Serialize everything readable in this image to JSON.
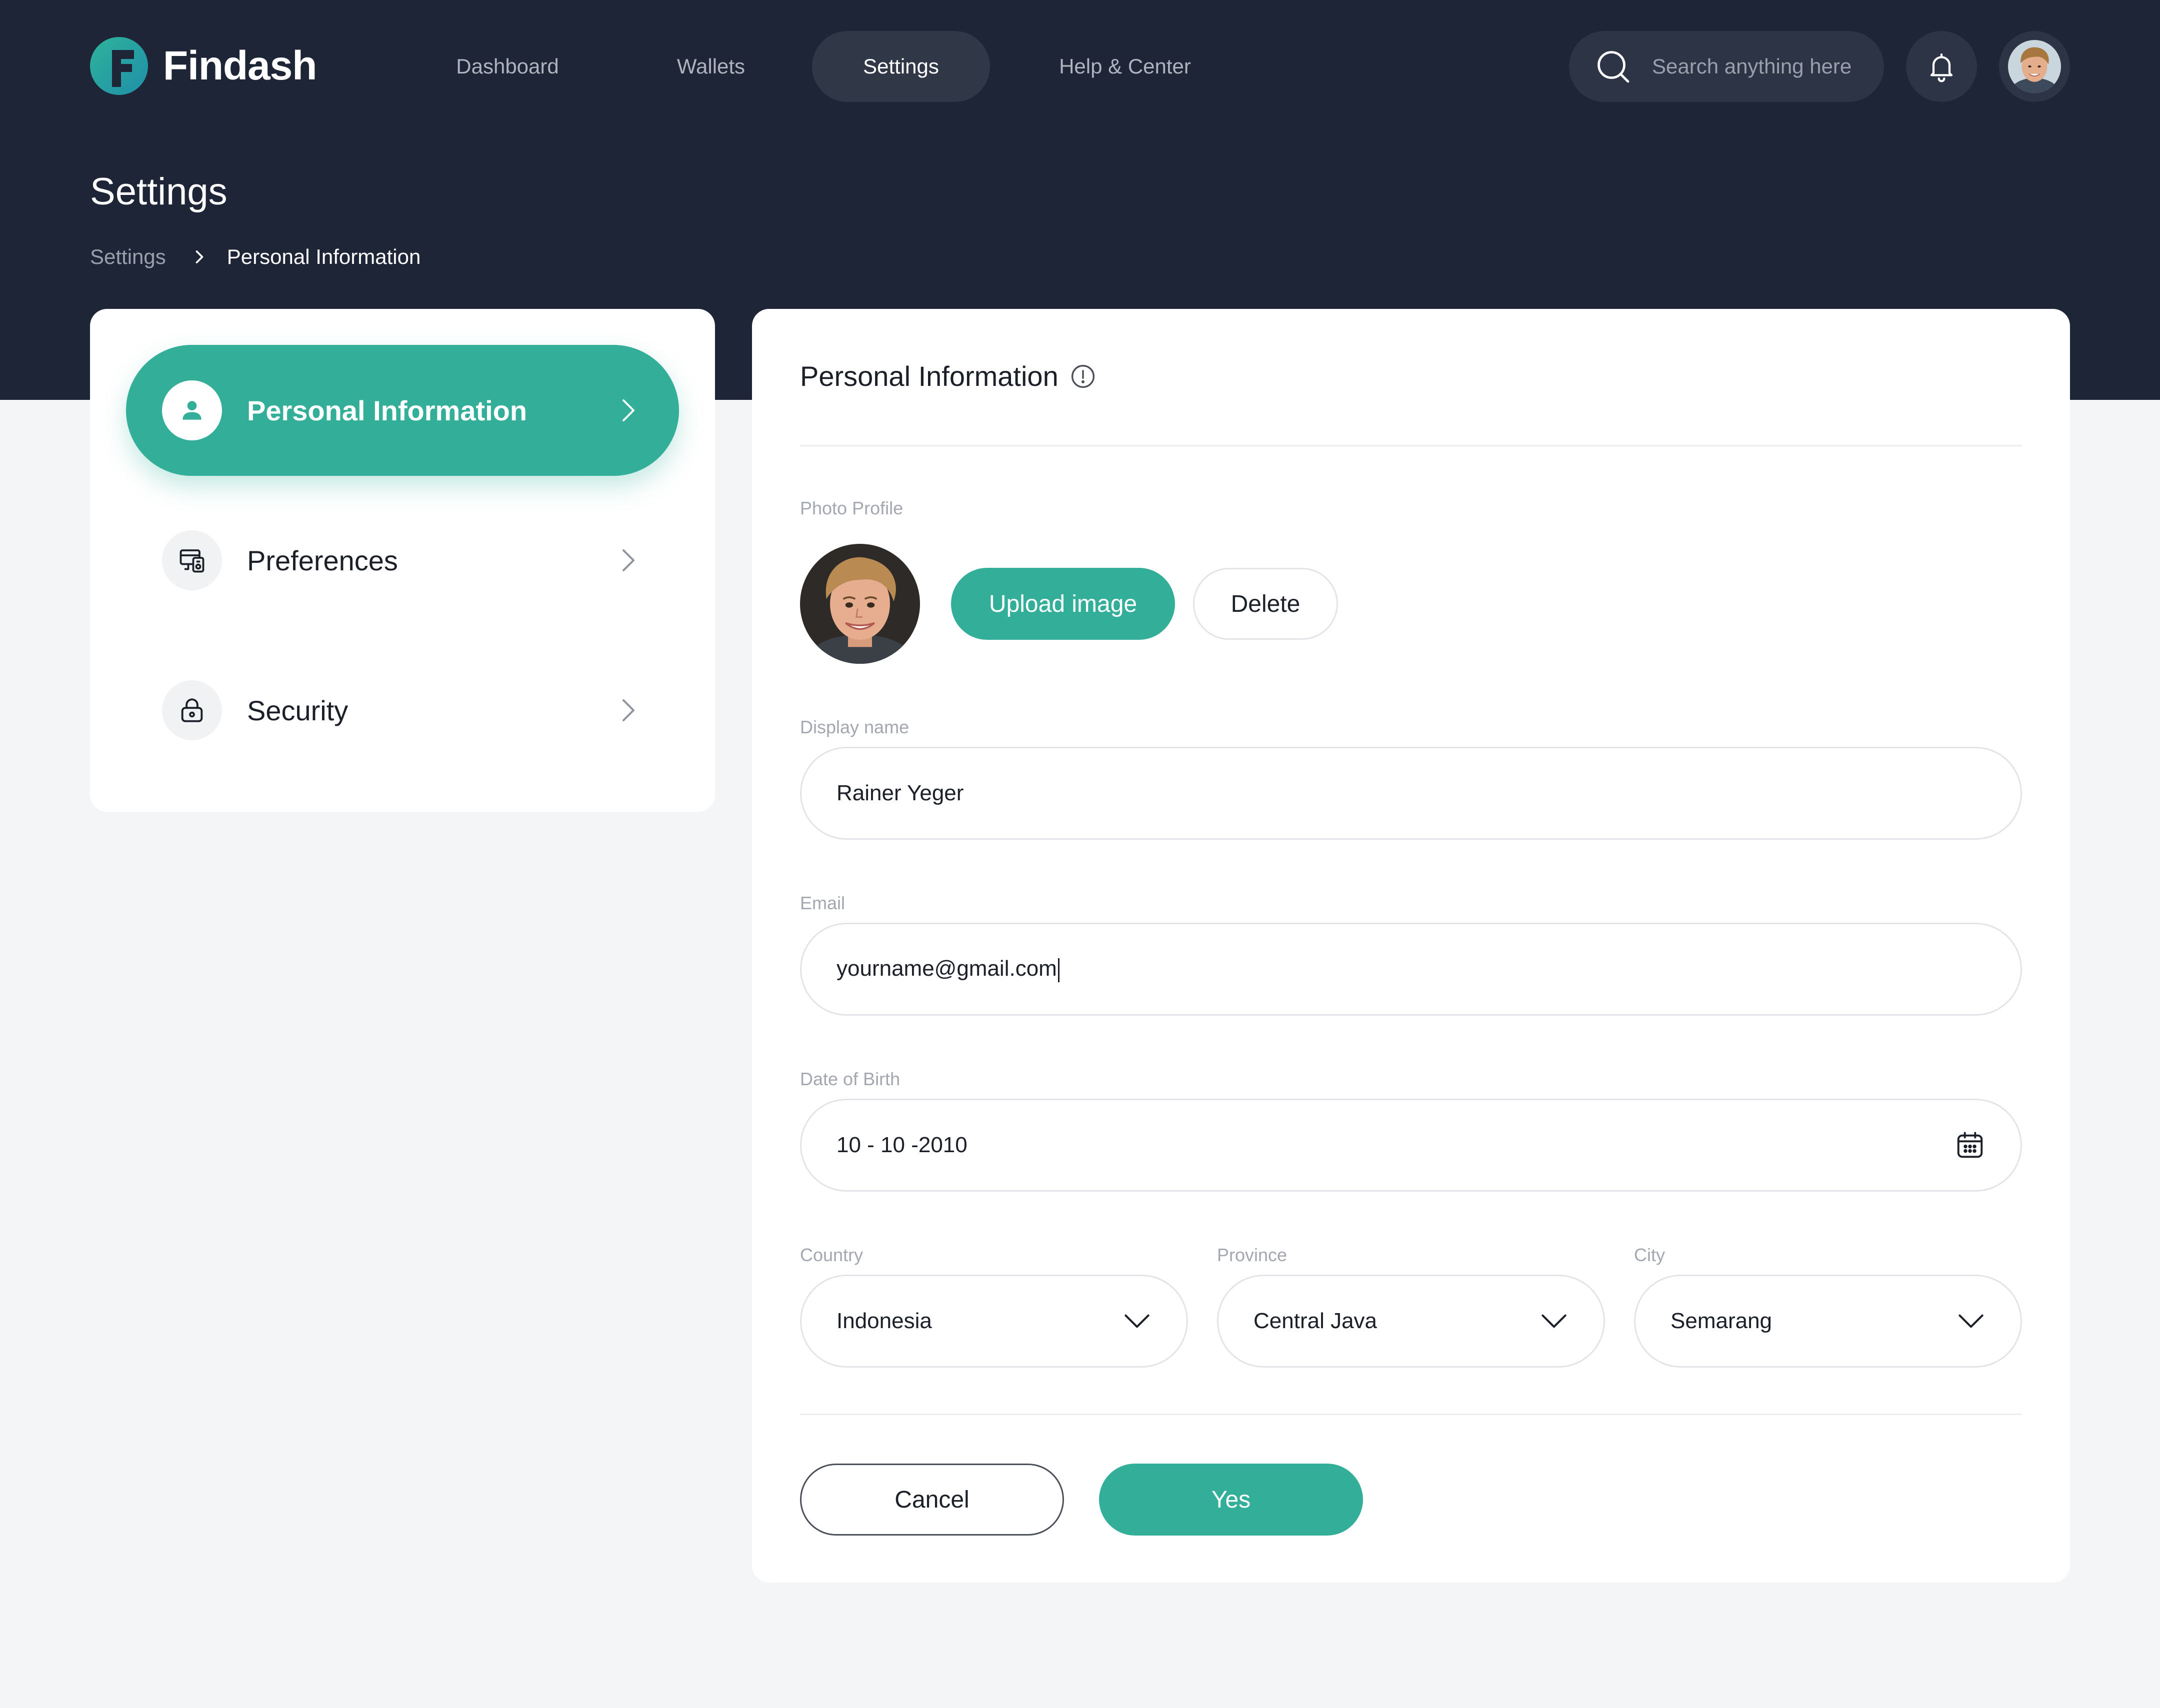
{
  "brand": {
    "name": "Findash",
    "accent": "#33af99",
    "header_bg": "#1e2536"
  },
  "nav": {
    "items": [
      {
        "label": "Dashboard"
      },
      {
        "label": "Wallets"
      },
      {
        "label": "Settings",
        "active": true
      },
      {
        "label": "Help & Center"
      }
    ]
  },
  "search": {
    "placeholder": "Search anything here",
    "icon": "search-icon"
  },
  "header": {
    "notification_icon": "bell-icon"
  },
  "page": {
    "title": "Settings"
  },
  "breadcrumb": {
    "items": [
      "Settings",
      "Personal Information"
    ]
  },
  "sidebar": {
    "items": [
      {
        "label": "Personal Information",
        "icon": "user-icon",
        "active": true
      },
      {
        "label": "Preferences",
        "icon": "preferences-icon"
      },
      {
        "label": "Security",
        "icon": "lock-icon"
      }
    ]
  },
  "form": {
    "title": "Personal Information",
    "photo_label": "Photo Profile",
    "upload_label": "Upload image",
    "delete_label": "Delete",
    "display_name": {
      "label": "Display name",
      "value": "Rainer Yeger"
    },
    "email": {
      "label": "Email",
      "value": "yourname@gmail.com"
    },
    "dob": {
      "label": "Date of Birth",
      "value": "10 - 10 -2010"
    },
    "country": {
      "label": "Country",
      "value": "Indonesia"
    },
    "province": {
      "label": "Province",
      "value": "Central Java"
    },
    "city": {
      "label": "City",
      "value": "Semarang"
    },
    "cancel_label": "Cancel",
    "submit_label": "Yes"
  }
}
